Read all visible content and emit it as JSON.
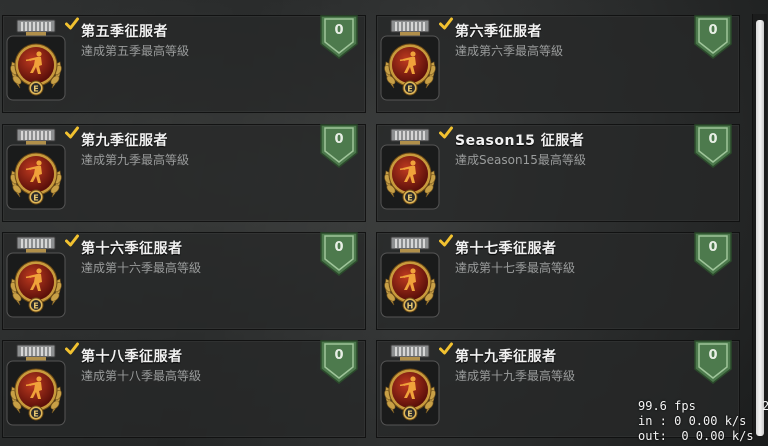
{
  "achievements": [
    {
      "title": "第五季征服者",
      "desc": "達成第五季最高等級",
      "count": "0",
      "emblem": "E"
    },
    {
      "title": "第六季征服者",
      "desc": "達成第六季最高等級",
      "count": "0",
      "emblem": "E"
    },
    {
      "title": "第九季征服者",
      "desc": "達成第九季最高等級",
      "count": "0",
      "emblem": "E"
    },
    {
      "title": "Season15 征服者",
      "desc": "達成Season15最高等級",
      "count": "0",
      "emblem": "E"
    },
    {
      "title": "第十六季征服者",
      "desc": "達成第十六季最高等級",
      "count": "0",
      "emblem": "E"
    },
    {
      "title": "第十七季征服者",
      "desc": "達成第十七季最高等級",
      "count": "0",
      "emblem": "H"
    },
    {
      "title": "第十八季征服者",
      "desc": "達成第十八季最高等級",
      "count": "0",
      "emblem": "E"
    },
    {
      "title": "第十九季征服者",
      "desc": "達成第十九季最高等級",
      "count": "0",
      "emblem": "E"
    }
  ],
  "stats": {
    "fps": "99.6 fps",
    "in": "in : 0 0.00 k/s",
    "out": "out:  0 0.00 k/s",
    "extra": "2"
  },
  "colors": {
    "card_bg": "#272929",
    "badge_green": "#4d7a4d",
    "medal_red": "#8c1a10",
    "gold": "#c8a046",
    "check_yellow": "#f2c230"
  },
  "icons": {
    "medal": "conqueror-medal-icon",
    "check": "checkmark-icon",
    "badge": "rank-shield-icon"
  }
}
